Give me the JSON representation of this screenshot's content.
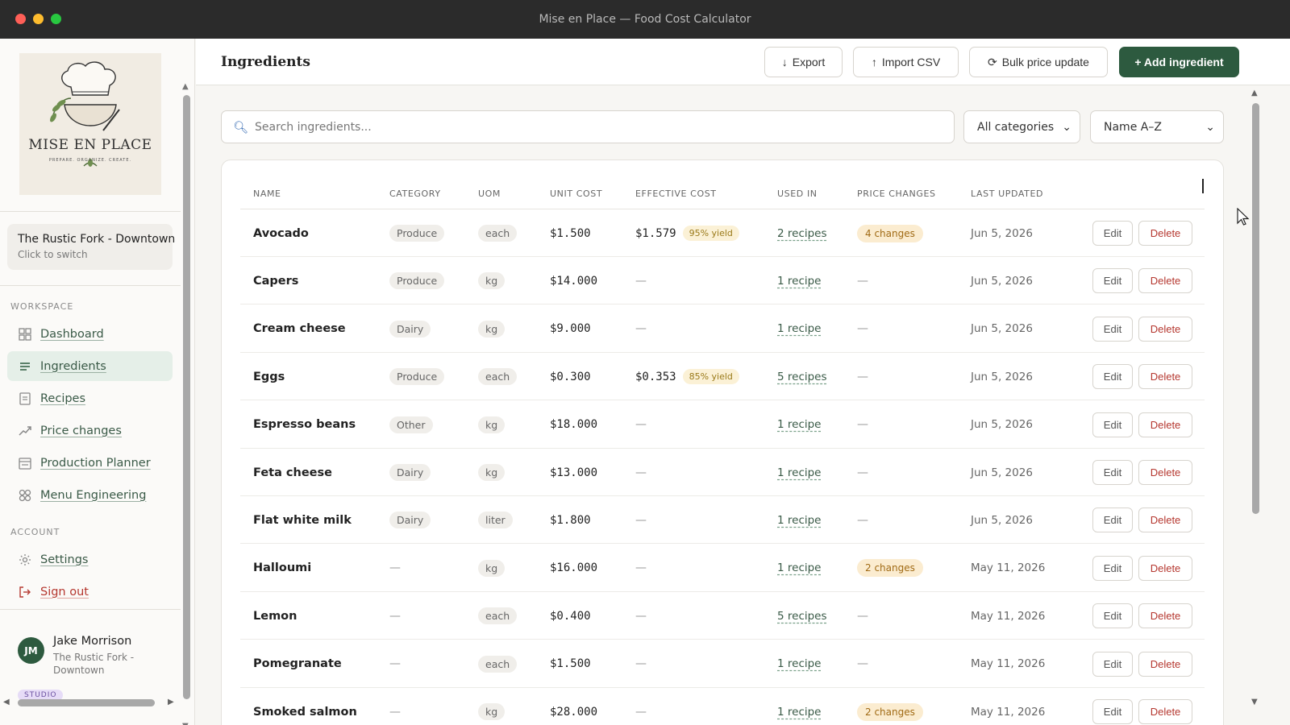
{
  "window": {
    "title": "Mise en Place — Food Cost Calculator"
  },
  "brand": {
    "logo_title": "MISE EN PLACE",
    "logo_tagline": "PREPARE. ORGANIZE. CREATE."
  },
  "location": {
    "name": "The Rustic Fork - Downtown",
    "hint": "Click to switch"
  },
  "sidebar": {
    "workspace_label": "WORKSPACE",
    "account_label": "ACCOUNT",
    "items": [
      {
        "label": "Dashboard",
        "icon": "grid-icon"
      },
      {
        "label": "Ingredients",
        "icon": "list-icon"
      },
      {
        "label": "Recipes",
        "icon": "document-icon"
      },
      {
        "label": "Price changes",
        "icon": "trend-icon"
      },
      {
        "label": "Production Planner",
        "icon": "calendar-icon"
      },
      {
        "label": "Menu Engineering",
        "icon": "matrix-icon"
      }
    ],
    "account_items": [
      {
        "label": "Settings",
        "icon": "gear-icon"
      },
      {
        "label": "Sign out",
        "icon": "sign-out-icon"
      }
    ],
    "active_item": "Ingredients"
  },
  "user": {
    "initials": "JM",
    "name": "Jake Morrison",
    "org": "The Rustic Fork - Downtown",
    "badge": "STUDIO"
  },
  "header": {
    "title": "Ingredients",
    "export_label": "Export",
    "import_label": "Import CSV",
    "bulk_label": "Bulk price update",
    "add_label": "+ Add ingredient"
  },
  "toolbar": {
    "search_placeholder": "Search ingredients...",
    "category_value": "All categories",
    "sort_value": "Name A–Z"
  },
  "table": {
    "columns": [
      "NAME",
      "CATEGORY",
      "UOM",
      "UNIT COST",
      "EFFECTIVE COST",
      "USED IN",
      "PRICE CHANGES",
      "LAST UPDATED"
    ],
    "edit_label": "Edit",
    "delete_label": "Delete",
    "rows": [
      {
        "name": "Avocado",
        "category": "Produce",
        "uom": "each",
        "unit_cost": "$1.500",
        "effective_cost": "$1.579",
        "yield": "95% yield",
        "used_in": "2 recipes",
        "price_changes": "4 changes",
        "last_updated": "Jun 5, 2026"
      },
      {
        "name": "Capers",
        "category": "Produce",
        "uom": "kg",
        "unit_cost": "$14.000",
        "effective_cost": "—",
        "yield": "",
        "used_in": "1 recipe",
        "price_changes": "—",
        "last_updated": "Jun 5, 2026"
      },
      {
        "name": "Cream cheese",
        "category": "Dairy",
        "uom": "kg",
        "unit_cost": "$9.000",
        "effective_cost": "—",
        "yield": "",
        "used_in": "1 recipe",
        "price_changes": "—",
        "last_updated": "Jun 5, 2026"
      },
      {
        "name": "Eggs",
        "category": "Produce",
        "uom": "each",
        "unit_cost": "$0.300",
        "effective_cost": "$0.353",
        "yield": "85% yield",
        "used_in": "5 recipes",
        "price_changes": "—",
        "last_updated": "Jun 5, 2026"
      },
      {
        "name": "Espresso beans",
        "category": "Other",
        "uom": "kg",
        "unit_cost": "$18.000",
        "effective_cost": "—",
        "yield": "",
        "used_in": "1 recipe",
        "price_changes": "—",
        "last_updated": "Jun 5, 2026"
      },
      {
        "name": "Feta cheese",
        "category": "Dairy",
        "uom": "kg",
        "unit_cost": "$13.000",
        "effective_cost": "—",
        "yield": "",
        "used_in": "1 recipe",
        "price_changes": "—",
        "last_updated": "Jun 5, 2026"
      },
      {
        "name": "Flat white milk",
        "category": "Dairy",
        "uom": "liter",
        "unit_cost": "$1.800",
        "effective_cost": "—",
        "yield": "",
        "used_in": "1 recipe",
        "price_changes": "—",
        "last_updated": "Jun 5, 2026"
      },
      {
        "name": "Halloumi",
        "category": "—",
        "uom": "kg",
        "unit_cost": "$16.000",
        "effective_cost": "—",
        "yield": "",
        "used_in": "1 recipe",
        "price_changes": "2 changes",
        "last_updated": "May 11, 2026"
      },
      {
        "name": "Lemon",
        "category": "—",
        "uom": "each",
        "unit_cost": "$0.400",
        "effective_cost": "—",
        "yield": "",
        "used_in": "5 recipes",
        "price_changes": "—",
        "last_updated": "May 11, 2026"
      },
      {
        "name": "Pomegranate",
        "category": "—",
        "uom": "each",
        "unit_cost": "$1.500",
        "effective_cost": "—",
        "yield": "",
        "used_in": "1 recipe",
        "price_changes": "—",
        "last_updated": "May 11, 2026"
      },
      {
        "name": "Smoked salmon",
        "category": "—",
        "uom": "kg",
        "unit_cost": "$28.000",
        "effective_cost": "—",
        "yield": "",
        "used_in": "1 recipe",
        "price_changes": "2 changes",
        "last_updated": "May 11, 2026"
      }
    ]
  },
  "colors": {
    "accent": "#2d5a3f",
    "danger": "#b5372f",
    "titlebar": "#2b2b2b"
  }
}
